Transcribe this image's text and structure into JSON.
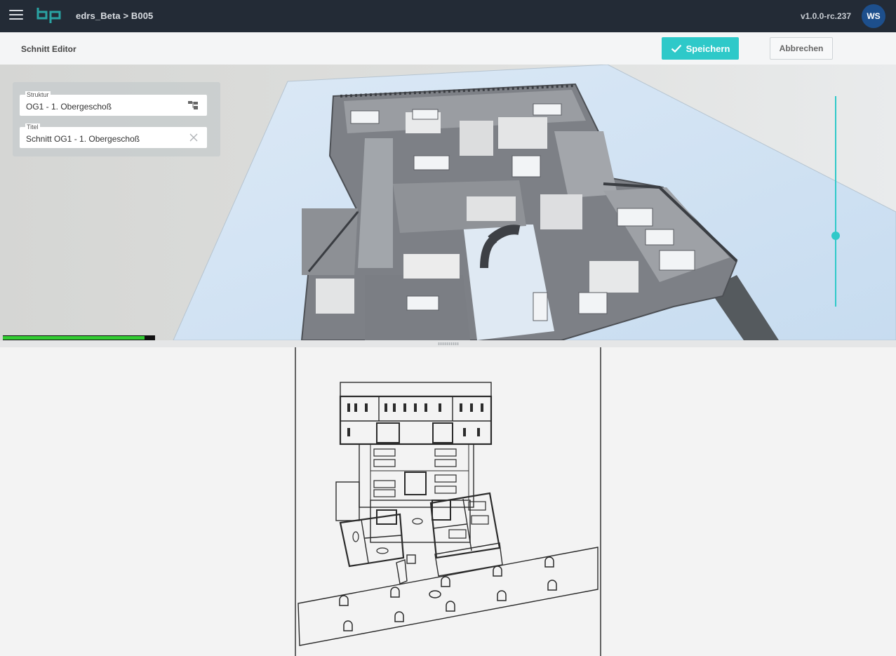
{
  "app": {
    "breadcrumb": "edrs_Beta > B005",
    "version": "v1.0.0-rc.237",
    "user_initials": "WS",
    "logo_icon": "bp-logo",
    "menu_icon": "hamburger-menu-icon"
  },
  "editor": {
    "title": "Schnitt Editor",
    "save_label": "Speichern",
    "cancel_label": "Abbrechen",
    "accent_color": "#2ec9c9"
  },
  "properties": {
    "struktur_label": "Struktur",
    "struktur_value": "OG1 - 1. Obergeschoß",
    "titel_label": "Titel",
    "titel_value": "Schnitt OG1 - 1. Obergeschoß"
  }
}
